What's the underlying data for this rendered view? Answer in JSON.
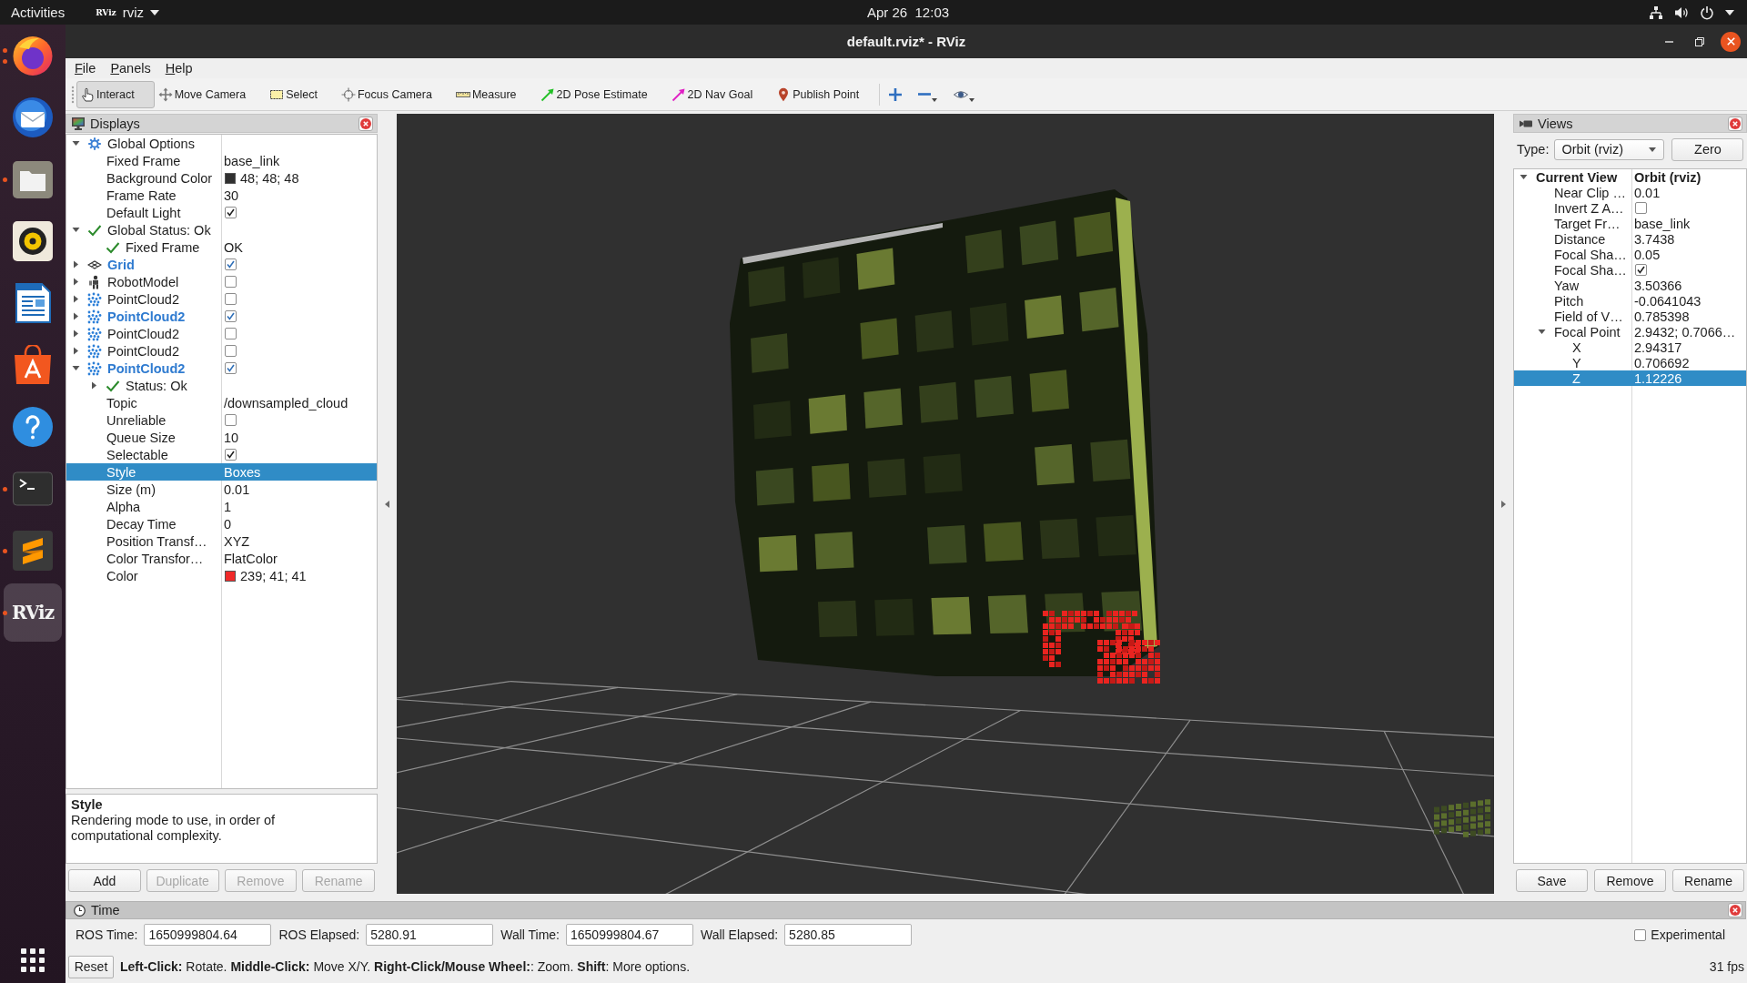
{
  "top_bar": {
    "activities": "Activities",
    "app_menu": {
      "logo": "RViz",
      "label": "rviz"
    },
    "clock": "Apr 26  12:03"
  },
  "dock": {
    "apps": [
      {
        "kind": "browser",
        "running": true,
        "several_windows": true,
        "selected": false
      },
      {
        "kind": "mail",
        "running": false,
        "several_windows": false,
        "selected": false
      },
      {
        "kind": "files",
        "running": true,
        "several_windows": false,
        "selected": false
      },
      {
        "kind": "music",
        "running": false,
        "several_windows": false,
        "selected": false
      },
      {
        "kind": "writer",
        "running": false,
        "several_windows": false,
        "selected": false
      },
      {
        "kind": "store",
        "running": false,
        "several_windows": false,
        "selected": false
      },
      {
        "kind": "help",
        "running": false,
        "several_windows": false,
        "selected": false
      },
      {
        "kind": "terminal",
        "running": true,
        "several_windows": false,
        "selected": false
      },
      {
        "kind": "editor",
        "running": true,
        "several_windows": false,
        "selected": false
      },
      {
        "kind": "rviz",
        "label": "RViz",
        "running": true,
        "several_windows": false,
        "selected": true
      }
    ]
  },
  "window": {
    "title": "default.rviz* - RViz"
  },
  "menu": [
    "File",
    "Panels",
    "Help"
  ],
  "toolbar": {
    "tools": [
      {
        "kind": "interact",
        "label": "Interact",
        "selected": true
      },
      {
        "kind": "move_camera",
        "label": "Move Camera",
        "selected": false
      },
      {
        "kind": "select",
        "label": "Select",
        "selected": false
      },
      {
        "kind": "focus_camera",
        "label": "Focus Camera",
        "selected": false
      },
      {
        "kind": "measure",
        "label": "Measure",
        "selected": false
      },
      {
        "kind": "pose_estimate",
        "label": "2D Pose Estimate",
        "selected": false
      },
      {
        "kind": "nav_goal",
        "label": "2D Nav Goal",
        "selected": false
      },
      {
        "kind": "publish_point",
        "label": "Publish Point",
        "selected": false
      }
    ],
    "view_buttons": [
      {
        "kind": "add"
      },
      {
        "kind": "remove"
      },
      {
        "kind": "camera"
      }
    ]
  },
  "displays": {
    "title": "Displays",
    "tree": [
      {
        "name": "Global Options",
        "kind": "options",
        "expanded": true,
        "selected": false,
        "children": [
          {
            "name": "Fixed Frame",
            "kind": "text",
            "value": "base_link",
            "selected": false
          },
          {
            "name": "Background Color",
            "kind": "color",
            "color": "#303030",
            "value": "48; 48; 48",
            "selected": false
          },
          {
            "name": "Frame Rate",
            "kind": "text",
            "value": "30",
            "selected": false
          },
          {
            "name": "Default Light",
            "kind": "check",
            "checked": true,
            "selected": false
          }
        ]
      },
      {
        "name": "Global Status: Ok",
        "kind": "status",
        "expanded": true,
        "selected": false,
        "children": [
          {
            "name": "Fixed Frame",
            "kind": "status_text",
            "value": "OK",
            "selected": false
          }
        ]
      },
      {
        "name": "Grid",
        "kind": "grid_display",
        "checked": true,
        "expanded": false,
        "selected": false
      },
      {
        "name": "RobotModel",
        "kind": "robot_display",
        "checked": false,
        "expanded": false,
        "selected": false
      },
      {
        "name": "PointCloud2",
        "kind": "cloud_display",
        "checked": false,
        "expanded": false,
        "selected": false
      },
      {
        "name": "PointCloud2",
        "kind": "cloud_display",
        "checked": true,
        "expanded": false,
        "selected": false
      },
      {
        "name": "PointCloud2",
        "kind": "cloud_display",
        "checked": false,
        "expanded": false,
        "selected": false
      },
      {
        "name": "PointCloud2",
        "kind": "cloud_display",
        "checked": false,
        "expanded": false,
        "selected": false
      },
      {
        "name": "PointCloud2",
        "kind": "cloud_display",
        "checked": true,
        "expanded": true,
        "selected": false,
        "children": [
          {
            "name": "Status: Ok",
            "kind": "status",
            "expanded": false,
            "selected": false
          },
          {
            "name": "Topic",
            "kind": "text",
            "value": "/downsampled_cloud",
            "selected": false
          },
          {
            "name": "Unreliable",
            "kind": "check",
            "checked": false,
            "selected": false
          },
          {
            "name": "Queue Size",
            "kind": "text",
            "value": "10",
            "selected": false
          },
          {
            "name": "Selectable",
            "kind": "check",
            "checked": true,
            "selected": false
          },
          {
            "name": "Style",
            "kind": "text",
            "value": "Boxes",
            "selected": true
          },
          {
            "name": "Size (m)",
            "kind": "text",
            "value": "0.01",
            "selected": false
          },
          {
            "name": "Alpha",
            "kind": "text",
            "value": "1",
            "selected": false
          },
          {
            "name": "Decay Time",
            "kind": "text",
            "value": "0",
            "selected": false
          },
          {
            "name": "Position Transf…",
            "kind": "text",
            "value": "XYZ",
            "selected": false
          },
          {
            "name": "Color Transfor…",
            "kind": "text",
            "value": "FlatColor",
            "selected": false
          },
          {
            "name": "Color",
            "kind": "color",
            "color": "#ef2929",
            "value": "239; 41; 41",
            "selected": false
          }
        ]
      }
    ],
    "description": {
      "title": "Style",
      "text": "Rendering mode to use, in order of computational complexity."
    },
    "buttons": [
      {
        "label": "Add",
        "disabled": false
      },
      {
        "label": "Duplicate",
        "disabled": true
      },
      {
        "label": "Remove",
        "disabled": true
      },
      {
        "label": "Rename",
        "disabled": true
      }
    ]
  },
  "views": {
    "title": "Views",
    "type_label": "Type:",
    "type_value": "Orbit (rviz)",
    "zero_button": "Zero",
    "tree": [
      {
        "name": "Current View",
        "kind": "header",
        "value": "Orbit (rviz)",
        "expanded": true,
        "selected": false,
        "children": [
          {
            "name": "Near Clip …",
            "kind": "text",
            "value": "0.01",
            "selected": false
          },
          {
            "name": "Invert Z A…",
            "kind": "check",
            "checked": false,
            "selected": false
          },
          {
            "name": "Target Fr…",
            "kind": "text",
            "value": "base_link",
            "selected": false
          },
          {
            "name": "Distance",
            "kind": "text",
            "value": "3.7438",
            "selected": false
          },
          {
            "name": "Focal Sha…",
            "kind": "text",
            "value": "0.05",
            "selected": false
          },
          {
            "name": "Focal Sha…",
            "kind": "check",
            "checked": true,
            "selected": false
          },
          {
            "name": "Yaw",
            "kind": "text",
            "value": "3.50366",
            "selected": false
          },
          {
            "name": "Pitch",
            "kind": "text",
            "value": "-0.0641043",
            "selected": false
          },
          {
            "name": "Field of V…",
            "kind": "text",
            "value": "0.785398",
            "selected": false
          },
          {
            "name": "Focal Point",
            "kind": "text",
            "value": "2.9432; 0.7066…",
            "expanded": true,
            "selected": false,
            "children": [
              {
                "name": "X",
                "kind": "text",
                "value": "2.94317",
                "selected": false
              },
              {
                "name": "Y",
                "kind": "text",
                "value": "0.706692",
                "selected": false
              },
              {
                "name": "Z",
                "kind": "text",
                "value": "1.12226",
                "selected": true
              }
            ]
          }
        ]
      }
    ],
    "buttons": [
      {
        "label": "Save",
        "disabled": false
      },
      {
        "label": "Remove",
        "disabled": false
      },
      {
        "label": "Rename",
        "disabled": false
      }
    ]
  },
  "time_panel": {
    "title": "Time",
    "fields": [
      {
        "label": "ROS Time:",
        "value": "1650999804.64"
      },
      {
        "label": "ROS Elapsed:",
        "value": "5280.91"
      },
      {
        "label": "Wall Time:",
        "value": "1650999804.67"
      },
      {
        "label": "Wall Elapsed:",
        "value": "5280.85"
      }
    ],
    "experimental": {
      "label": "Experimental",
      "checked": false
    }
  },
  "status_bar": {
    "reset_button": "Reset",
    "hint": "**Left-Click:** Rotate. **Middle-Click:** Move X/Y. **Right-Click/Mouse Wheel:**: Zoom. **Shift**: More options.",
    "fps": "31 fps"
  }
}
